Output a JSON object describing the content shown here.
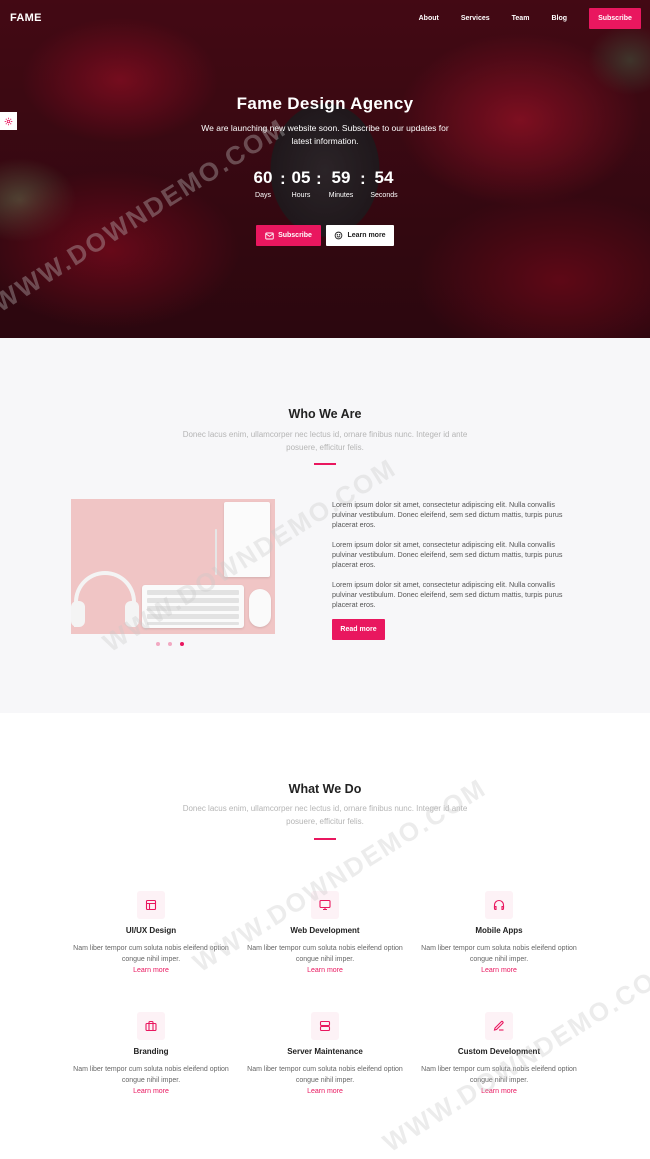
{
  "brand": "FAME",
  "nav": {
    "links": [
      "About",
      "Services",
      "Team",
      "Blog"
    ],
    "subscribe": "Subscribe"
  },
  "hero": {
    "title": "Fame Design Agency",
    "subtitle": "We are launching new website soon. Subscribe to our updates for latest information.",
    "countdown": [
      {
        "value": "60",
        "label": "Days"
      },
      {
        "value": "05",
        "label": "Hours"
      },
      {
        "value": "59",
        "label": "Minutes"
      },
      {
        "value": "54",
        "label": "Seconds"
      }
    ],
    "separator": ":",
    "subscribe_label": "Subscribe",
    "learn_label": "Learn more"
  },
  "who": {
    "title": "Who We Are",
    "subtitle": "Donec lacus enim, ullamcorper nec lectus id, ornare finibus nunc. Integer id ante posuere, efficitur felis.",
    "paragraphs": [
      "Lorem ipsum dolor sit amet, consectetur adipiscing elit. Nulla convallis pulvinar vestibulum. Donec eleifend, sem sed dictum mattis, turpis purus placerat eros.",
      "Lorem ipsum dolor sit amet, consectetur adipiscing elit. Nulla convallis pulvinar vestibulum. Donec eleifend, sem sed dictum mattis, turpis purus placerat eros.",
      "Lorem ipsum dolor sit amet, consectetur adipiscing elit. Nulla convallis pulvinar vestibulum. Donec eleifend, sem sed dictum mattis, turpis purus placerat eros."
    ],
    "read_more": "Read more",
    "slides": 3,
    "active_slide": 3
  },
  "what": {
    "title": "What We Do",
    "subtitle": "Donec lacus enim, ullamcorper nec lectus id, ornare finibus nunc. Integer id ante posuere, efficitur felis.",
    "services": [
      {
        "icon": "layout-icon",
        "title": "UI/UX Design",
        "desc": "Nam liber tempor cum soluta nobis eleifend option congue nihil imper.",
        "link": "Learn more"
      },
      {
        "icon": "monitor-icon",
        "title": "Web Development",
        "desc": "Nam liber tempor cum soluta nobis eleifend option congue nihil imper.",
        "link": "Learn more"
      },
      {
        "icon": "headphones-icon",
        "title": "Mobile Apps",
        "desc": "Nam liber tempor cum soluta nobis eleifend option congue nihil imper.",
        "link": "Learn more"
      },
      {
        "icon": "briefcase-icon",
        "title": "Branding",
        "desc": "Nam liber tempor cum soluta nobis eleifend option congue nihil imper.",
        "link": "Learn more"
      },
      {
        "icon": "server-icon",
        "title": "Server Maintenance",
        "desc": "Nam liber tempor cum soluta nobis eleifend option congue nihil imper.",
        "link": "Learn more"
      },
      {
        "icon": "edit-icon",
        "title": "Custom Development",
        "desc": "Nam liber tempor cum soluta nobis eleifend option congue nihil imper.",
        "link": "Learn more"
      }
    ]
  },
  "watermark": "WWW.DOWNDEMO.COM",
  "colors": {
    "accent": "#e9175f"
  }
}
